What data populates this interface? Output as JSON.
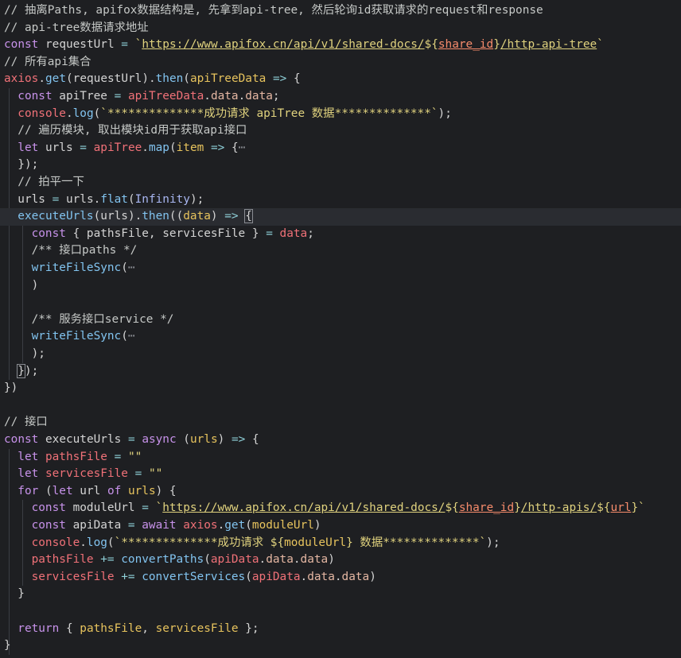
{
  "editor": {
    "lines": [
      {
        "indent": 0,
        "tokens": [
          [
            "comment",
            "// 抽离Paths, apifox数据结构是, 先拿到api-tree, 然后轮询id获取请求的request和response"
          ]
        ]
      },
      {
        "indent": 0,
        "tokens": [
          [
            "comment",
            "// api-tree数据请求地址"
          ]
        ]
      },
      {
        "indent": 0,
        "tokens": [
          [
            "kw",
            "const"
          ],
          [
            "var",
            " requestUrl "
          ],
          [
            "op",
            "="
          ],
          [
            "punc",
            " "
          ],
          [
            "str",
            "`"
          ],
          [
            "url",
            "https://www.apifox.cn/api/v1/shared-docs/"
          ],
          [
            "str",
            "${"
          ],
          [
            "interp",
            "share_id"
          ],
          [
            "str",
            "}"
          ],
          [
            "url",
            "/http-api-tree"
          ],
          [
            "str",
            "`"
          ]
        ]
      },
      {
        "indent": 0,
        "tokens": [
          [
            "comment",
            "// 所有api集合"
          ]
        ]
      },
      {
        "indent": 0,
        "tokens": [
          [
            "obj",
            "axios"
          ],
          [
            "punc",
            "."
          ],
          [
            "fn",
            "get"
          ],
          [
            "punc",
            "("
          ],
          [
            "var",
            "requestUrl"
          ],
          [
            "punc",
            ")."
          ],
          [
            "fn",
            "then"
          ],
          [
            "punc",
            "("
          ],
          [
            "param",
            "apiTreeData"
          ],
          [
            "op",
            " =>"
          ],
          [
            "punc",
            " {"
          ]
        ]
      },
      {
        "indent": 1,
        "tokens": [
          [
            "kw",
            "const"
          ],
          [
            "var",
            " apiTree "
          ],
          [
            "op",
            "="
          ],
          [
            "punc",
            " "
          ],
          [
            "obj",
            "apiTreeData"
          ],
          [
            "punc",
            "."
          ],
          [
            "prop",
            "data"
          ],
          [
            "punc",
            "."
          ],
          [
            "prop",
            "data"
          ],
          [
            "punc",
            ";"
          ]
        ]
      },
      {
        "indent": 1,
        "tokens": [
          [
            "obj",
            "console"
          ],
          [
            "punc",
            "."
          ],
          [
            "fn",
            "log"
          ],
          [
            "punc",
            "("
          ],
          [
            "str",
            "`**************成功请求 apiTree 数据**************`"
          ],
          [
            "punc",
            ");"
          ]
        ]
      },
      {
        "indent": 1,
        "tokens": [
          [
            "comment",
            "// 遍历模块, 取出模块id用于获取api接口"
          ]
        ]
      },
      {
        "indent": 1,
        "tokens": [
          [
            "kw",
            "let"
          ],
          [
            "var",
            " urls "
          ],
          [
            "op",
            "="
          ],
          [
            "punc",
            " "
          ],
          [
            "obj",
            "apiTree"
          ],
          [
            "punc",
            "."
          ],
          [
            "fn",
            "map"
          ],
          [
            "punc",
            "("
          ],
          [
            "param",
            "item"
          ],
          [
            "op",
            " =>"
          ],
          [
            "punc",
            " {"
          ],
          [
            "fold",
            "⋯"
          ]
        ]
      },
      {
        "indent": 1,
        "tokens": [
          [
            "punc",
            "});"
          ]
        ]
      },
      {
        "indent": 1,
        "tokens": [
          [
            "comment",
            "// 拍平一下"
          ]
        ]
      },
      {
        "indent": 1,
        "tokens": [
          [
            "var",
            "urls "
          ],
          [
            "op",
            "="
          ],
          [
            "var",
            " urls"
          ],
          [
            "punc",
            "."
          ],
          [
            "fn",
            "flat"
          ],
          [
            "punc",
            "("
          ],
          [
            "builtin",
            "Infinity"
          ],
          [
            "punc",
            ");"
          ]
        ]
      },
      {
        "indent": 1,
        "hl": true,
        "tokens": [
          [
            "fnname",
            "executeUrls"
          ],
          [
            "punc",
            "("
          ],
          [
            "var",
            "urls"
          ],
          [
            "punc",
            ")."
          ],
          [
            "fn",
            "then"
          ],
          [
            "punc",
            "(("
          ],
          [
            "param",
            "data"
          ],
          [
            "punc",
            ")"
          ],
          [
            "op",
            " =>"
          ],
          [
            "punc",
            " "
          ],
          [
            "bracket",
            "{"
          ]
        ]
      },
      {
        "indent": 2,
        "tokens": [
          [
            "kw",
            "const"
          ],
          [
            "punc",
            " { "
          ],
          [
            "var",
            "pathsFile"
          ],
          [
            "punc",
            ", "
          ],
          [
            "var",
            "servicesFile"
          ],
          [
            "punc",
            " } "
          ],
          [
            "op",
            "="
          ],
          [
            "punc",
            " "
          ],
          [
            "obj",
            "data"
          ],
          [
            "punc",
            ";"
          ]
        ]
      },
      {
        "indent": 2,
        "tokens": [
          [
            "comment",
            "/** 接口paths */"
          ]
        ]
      },
      {
        "indent": 2,
        "tokens": [
          [
            "fn",
            "writeFileSync"
          ],
          [
            "punc",
            "("
          ],
          [
            "fold",
            "⋯"
          ]
        ]
      },
      {
        "indent": 2,
        "tokens": [
          [
            "punc",
            ")"
          ]
        ]
      },
      {
        "indent": 0,
        "tokens": []
      },
      {
        "indent": 2,
        "tokens": [
          [
            "comment",
            "/** 服务接口service */"
          ]
        ]
      },
      {
        "indent": 2,
        "tokens": [
          [
            "fn",
            "writeFileSync"
          ],
          [
            "punc",
            "("
          ],
          [
            "fold",
            "⋯"
          ]
        ]
      },
      {
        "indent": 2,
        "tokens": [
          [
            "punc",
            ");"
          ]
        ]
      },
      {
        "indent": 1,
        "tokens": [
          [
            "bracket",
            "}"
          ],
          [
            "punc",
            ");"
          ]
        ]
      },
      {
        "indent": 0,
        "tokens": [
          [
            "punc",
            "})"
          ]
        ]
      },
      {
        "indent": 0,
        "tokens": []
      },
      {
        "indent": 0,
        "tokens": [
          [
            "comment",
            "// 接口"
          ]
        ]
      },
      {
        "indent": 0,
        "tokens": [
          [
            "kw",
            "const"
          ],
          [
            "var",
            " executeUrls "
          ],
          [
            "op",
            "="
          ],
          [
            "punc",
            " "
          ],
          [
            "kw",
            "async"
          ],
          [
            "punc",
            " ("
          ],
          [
            "param",
            "urls"
          ],
          [
            "punc",
            ")"
          ],
          [
            "op",
            " =>"
          ],
          [
            "punc",
            " {"
          ]
        ]
      },
      {
        "indent": 1,
        "tokens": [
          [
            "kw",
            "let"
          ],
          [
            "obj",
            " pathsFile"
          ],
          [
            "op",
            " ="
          ],
          [
            "punc",
            " "
          ],
          [
            "str",
            "\"\""
          ]
        ]
      },
      {
        "indent": 1,
        "tokens": [
          [
            "kw",
            "let"
          ],
          [
            "obj",
            " servicesFile"
          ],
          [
            "op",
            " ="
          ],
          [
            "punc",
            " "
          ],
          [
            "str",
            "\"\""
          ]
        ]
      },
      {
        "indent": 1,
        "tokens": [
          [
            "kw",
            "for"
          ],
          [
            "punc",
            " ("
          ],
          [
            "kw",
            "let"
          ],
          [
            "var",
            " url "
          ],
          [
            "kw",
            "of"
          ],
          [
            "punc",
            " "
          ],
          [
            "param",
            "urls"
          ],
          [
            "punc",
            ") {"
          ]
        ]
      },
      {
        "indent": 2,
        "tokens": [
          [
            "kw",
            "const"
          ],
          [
            "var",
            " moduleUrl "
          ],
          [
            "op",
            "="
          ],
          [
            "punc",
            " "
          ],
          [
            "str",
            "`"
          ],
          [
            "url",
            "https://www.apifox.cn/api/v1/shared-docs/"
          ],
          [
            "str",
            "${"
          ],
          [
            "interp",
            "share_id"
          ],
          [
            "str",
            "}"
          ],
          [
            "url",
            "/http-apis/"
          ],
          [
            "str",
            "${"
          ],
          [
            "interp",
            "url"
          ],
          [
            "str",
            "}"
          ],
          [
            "str",
            "`"
          ]
        ]
      },
      {
        "indent": 2,
        "tokens": [
          [
            "kw",
            "const"
          ],
          [
            "var",
            " apiData "
          ],
          [
            "op",
            "="
          ],
          [
            "punc",
            " "
          ],
          [
            "kw",
            "await"
          ],
          [
            "punc",
            " "
          ],
          [
            "obj",
            "axios"
          ],
          [
            "punc",
            "."
          ],
          [
            "fn",
            "get"
          ],
          [
            "punc",
            "("
          ],
          [
            "param",
            "moduleUrl"
          ],
          [
            "punc",
            ")"
          ]
        ]
      },
      {
        "indent": 2,
        "tokens": [
          [
            "obj",
            "console"
          ],
          [
            "punc",
            "."
          ],
          [
            "fn",
            "log"
          ],
          [
            "punc",
            "("
          ],
          [
            "str",
            "`**************成功请求 "
          ],
          [
            "str",
            "${"
          ],
          [
            "param",
            "moduleUrl"
          ],
          [
            "str",
            "}"
          ],
          [
            "str",
            " 数据**************`"
          ],
          [
            "punc",
            ");"
          ]
        ]
      },
      {
        "indent": 2,
        "tokens": [
          [
            "obj",
            "pathsFile"
          ],
          [
            "op",
            " +="
          ],
          [
            "punc",
            " "
          ],
          [
            "fn",
            "convertPaths"
          ],
          [
            "punc",
            "("
          ],
          [
            "obj",
            "apiData"
          ],
          [
            "punc",
            "."
          ],
          [
            "prop",
            "data"
          ],
          [
            "punc",
            "."
          ],
          [
            "prop",
            "data"
          ],
          [
            "punc",
            ")"
          ]
        ]
      },
      {
        "indent": 2,
        "tokens": [
          [
            "obj",
            "servicesFile"
          ],
          [
            "op",
            " +="
          ],
          [
            "punc",
            " "
          ],
          [
            "fn",
            "convertServices"
          ],
          [
            "punc",
            "("
          ],
          [
            "obj",
            "apiData"
          ],
          [
            "punc",
            "."
          ],
          [
            "prop",
            "data"
          ],
          [
            "punc",
            "."
          ],
          [
            "prop",
            "data"
          ],
          [
            "punc",
            ")"
          ]
        ]
      },
      {
        "indent": 1,
        "tokens": [
          [
            "punc",
            "}"
          ]
        ]
      },
      {
        "indent": 0,
        "tokens": []
      },
      {
        "indent": 1,
        "tokens": [
          [
            "kw",
            "return"
          ],
          [
            "punc",
            " { "
          ],
          [
            "param",
            "pathsFile"
          ],
          [
            "punc",
            ", "
          ],
          [
            "param",
            "servicesFile"
          ],
          [
            "punc",
            " };"
          ]
        ]
      },
      {
        "indent": 0,
        "tokens": [
          [
            "punc",
            "}"
          ]
        ]
      }
    ]
  }
}
